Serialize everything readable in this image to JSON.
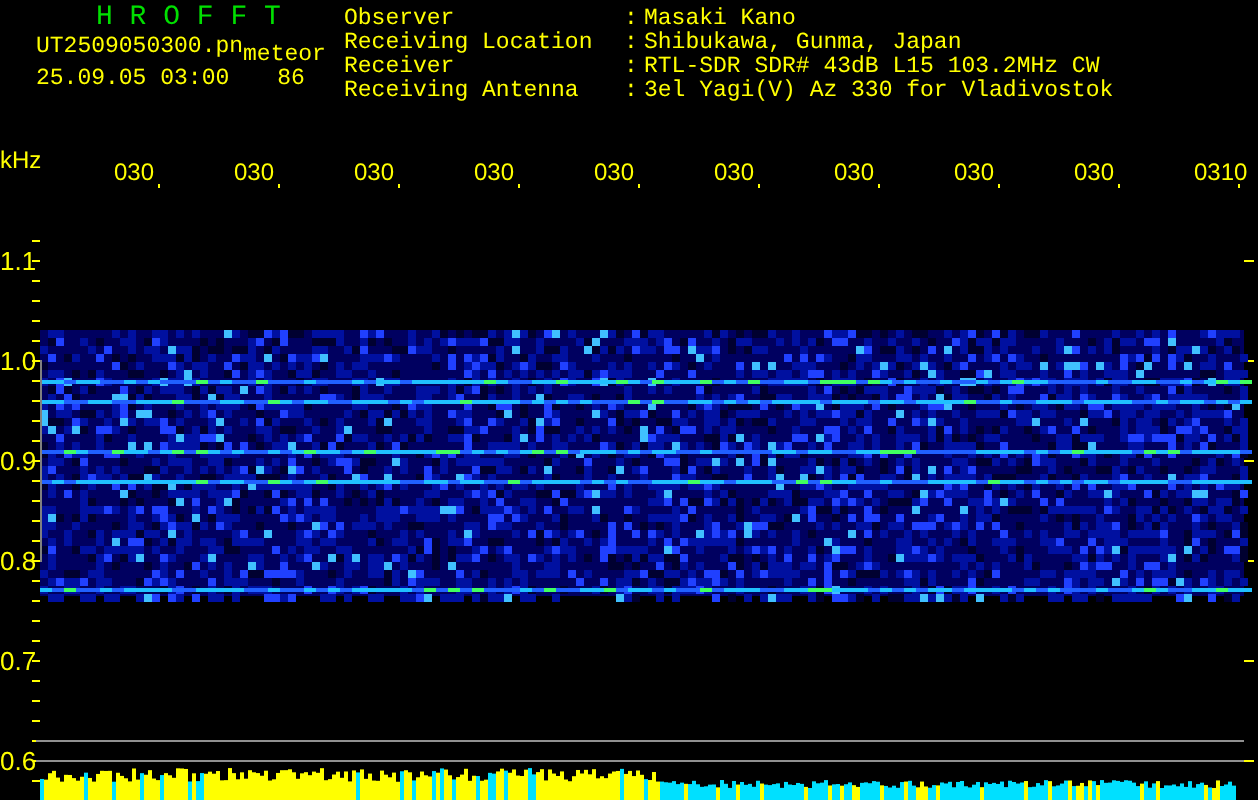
{
  "header": {
    "title": "H R O F F T",
    "file_name": "UT2509050300.pn",
    "mode": "meteor",
    "date_time": "25.09.05 03:00",
    "count": "86"
  },
  "info": [
    {
      "label": "Observer",
      "separator": ":",
      "value": "Masaki Kano"
    },
    {
      "label": "Receiving Location",
      "separator": ":",
      "value": "Shibukawa, Gunma, Japan"
    },
    {
      "label": "Receiver",
      "separator": ":",
      "value": "RTL-SDR SDR# 43dB L15 103.2MHz CW"
    },
    {
      "label": "Receiving Antenna",
      "separator": ":",
      "value": "3el Yagi(V) Az 330 for Vladivostok"
    }
  ],
  "plot": {
    "unit": "kHz",
    "time_labels": [
      "030",
      "030",
      "030",
      "030",
      "030",
      "030",
      "030",
      "030",
      "030",
      "0310"
    ],
    "frequency_labels": [
      "1.1",
      "1.0",
      "0.9",
      "0.8",
      "0.7",
      "0.6"
    ]
  }
}
